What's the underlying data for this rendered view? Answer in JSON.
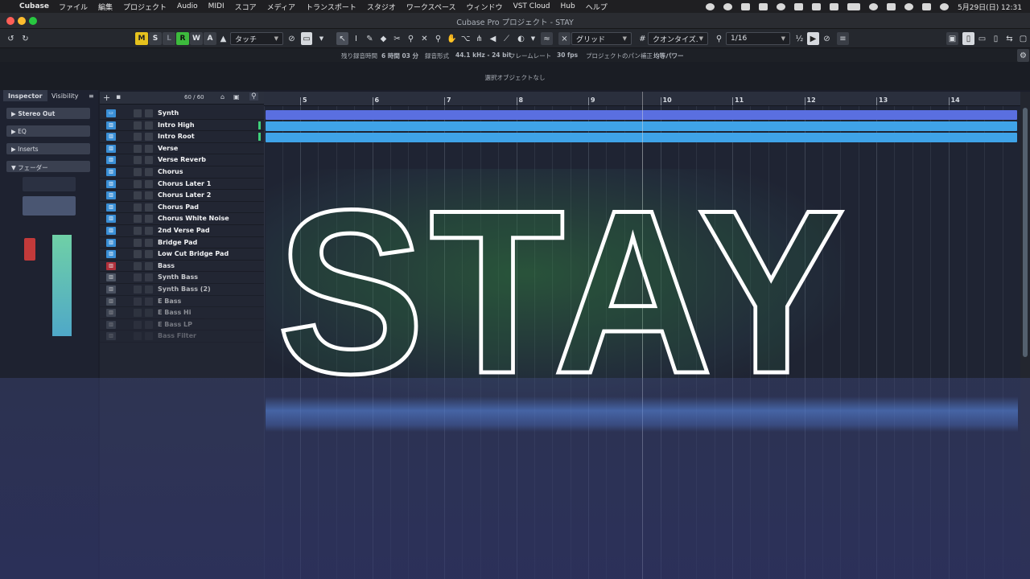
{
  "menubar": {
    "app": "Cubase",
    "items": [
      "ファイル",
      "編集",
      "プロジェクト",
      "Audio",
      "MIDI",
      "スコア",
      "メディア",
      "トランスポート",
      "スタジオ",
      "ワークスペース",
      "ウィンドウ",
      "VST Cloud",
      "Hub",
      "ヘルプ"
    ],
    "clock": "5月29日(日) 12:31"
  },
  "window": {
    "title": "Cubase Pro プロジェクト - STAY"
  },
  "toolbar": {
    "modes": [
      "M",
      "S",
      "L",
      "R",
      "W",
      "A"
    ],
    "automation_mode": "タッチ",
    "snap_type": "グリッド",
    "quantize_label": "クオンタイズ.",
    "quantize_value": "1/16"
  },
  "infoline": {
    "rec_time_label": "残り録音時間",
    "rec_time_value": "6 時間 03 分",
    "rec_format_label": "録音形式",
    "rec_format_value": "44.1 kHz - 24 bit",
    "frame_rate_label": "フレームレート",
    "frame_rate_value": "30 fps",
    "pan_label": "プロジェクトのパン補正",
    "pan_value": "均等パワー"
  },
  "status": {
    "selection": "選択オブジェクトなし"
  },
  "inspector": {
    "tabs": [
      "Inspector",
      "Visibility"
    ],
    "sections": [
      "Stereo Out",
      "EQ",
      "Inserts",
      "フェーダー"
    ]
  },
  "tracklist": {
    "counter": "60 / 60",
    "tracks": [
      "Synth",
      "Intro High",
      "Intro Root",
      "Verse",
      "Verse Reverb",
      "Chorus",
      "Chorus Later 1",
      "Chorus Later 2",
      "Chorus Pad",
      "Chorus White Noise",
      "2nd Verse Pad",
      "Bridge Pad",
      "Low Cut Bridge Pad",
      "Bass",
      "Synth Bass",
      "Synth Bass (2)",
      "E Bass",
      "E Bass Hi",
      "E Bass LP",
      "Bass Filter"
    ]
  },
  "ruler": {
    "bars": [
      "5",
      "6",
      "7",
      "8",
      "9",
      "10",
      "11",
      "12",
      "13",
      "14"
    ]
  },
  "overlay": {
    "title": "STAY"
  },
  "colors": {
    "accent_blue": "#3fa3e8",
    "part_purple": "#5a6fe0",
    "title_glow": "#3faa46"
  }
}
